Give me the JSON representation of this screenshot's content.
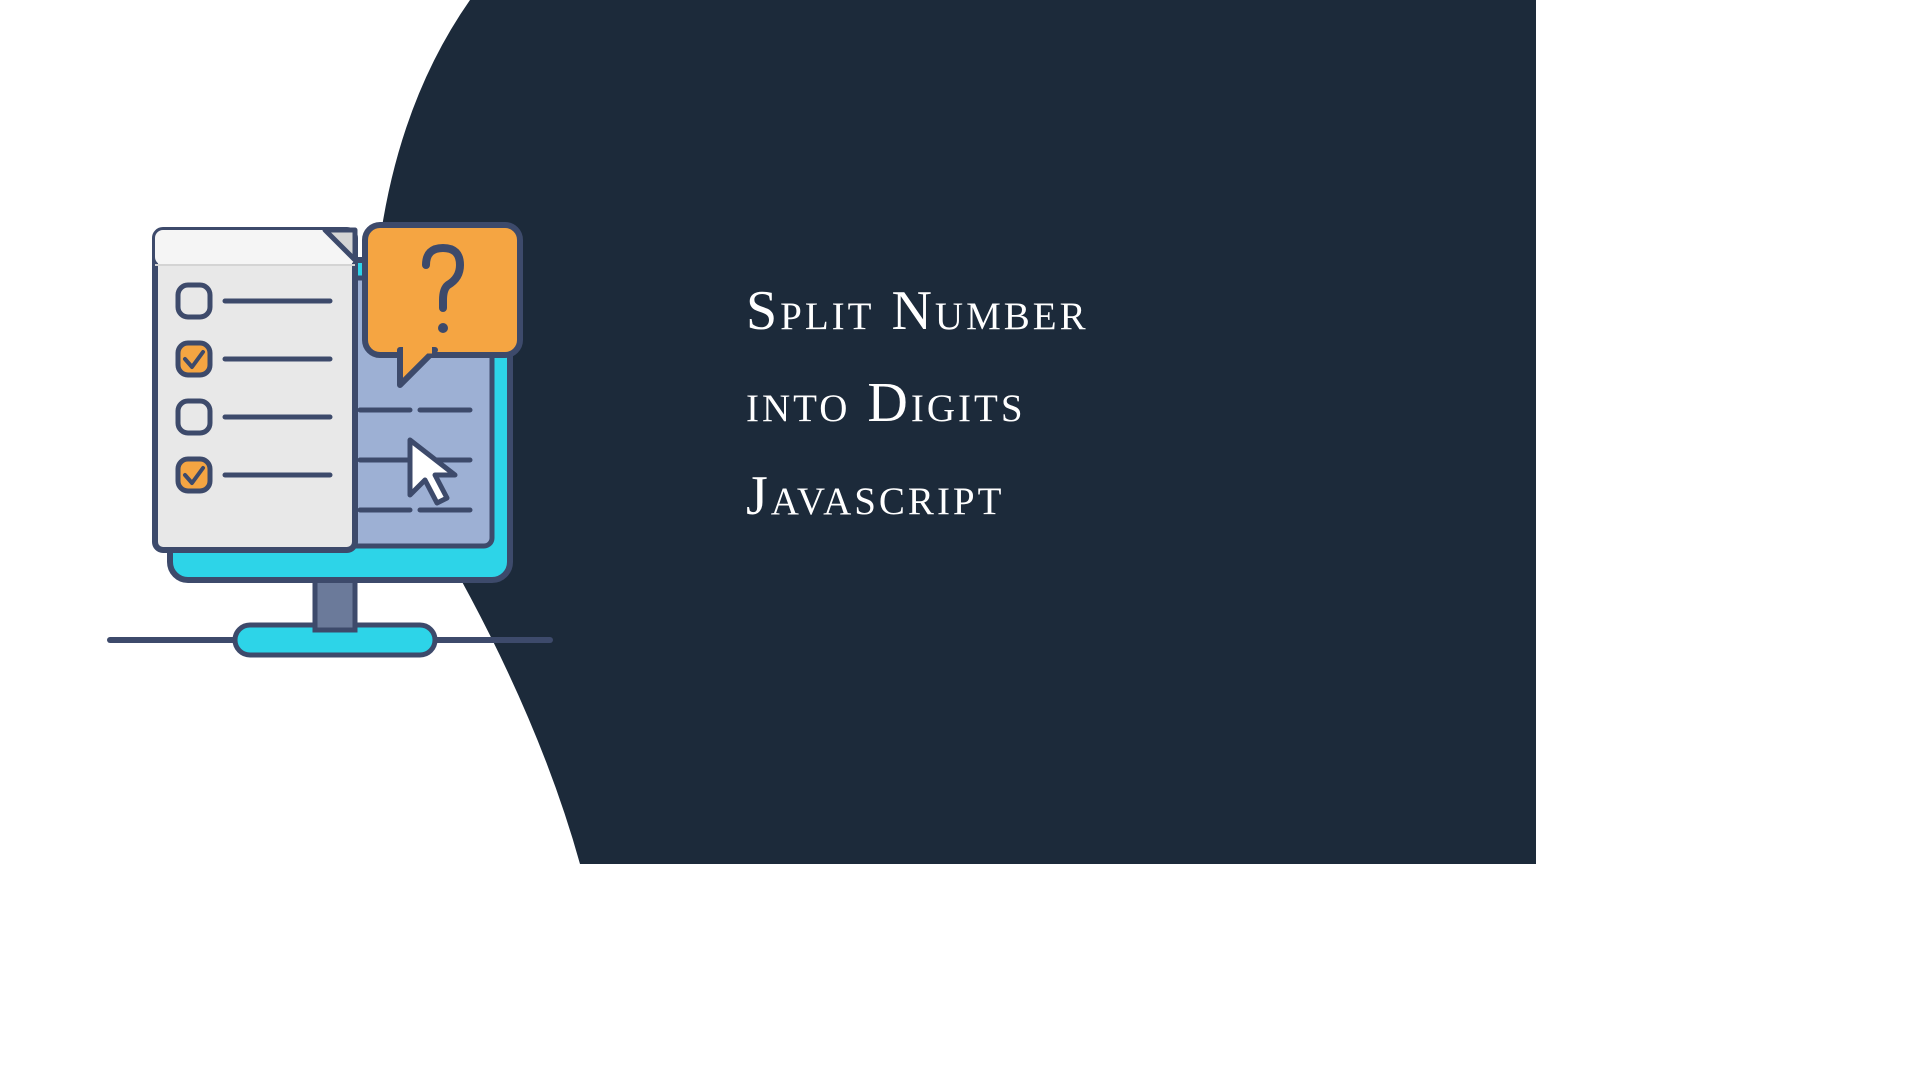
{
  "title": {
    "line1": "Split Number",
    "line2": "into Digits",
    "line3": "Javascript"
  },
  "colors": {
    "background": "#1c2a3a",
    "white": "#ffffff",
    "cyan": "#2dd4e8",
    "orange": "#f5a542",
    "darkBlue": "#3d4a6b",
    "lightBlue": "#b8c4dc",
    "screenBlue": "#9db0d4",
    "paperGray": "#e8e8e8",
    "paperLight": "#f5f5f5"
  },
  "illustration": {
    "name": "computer-checklist-question",
    "elements": [
      "monitor",
      "checklist-page",
      "question-bubble",
      "cursor"
    ]
  }
}
